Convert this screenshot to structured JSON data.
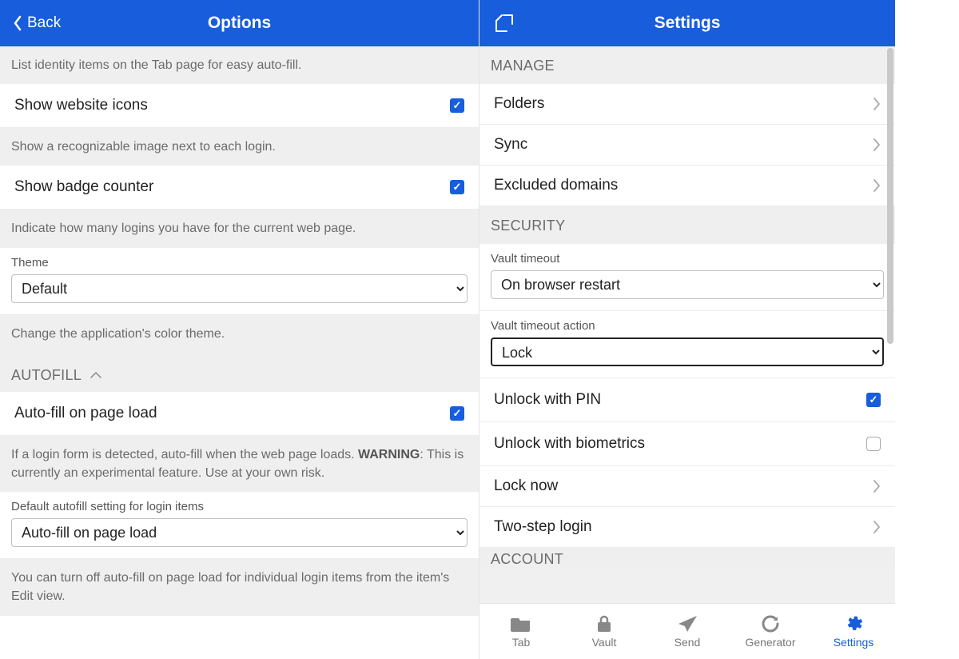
{
  "left": {
    "back_label": "Back",
    "title": "Options",
    "identity_help": "List identity items on the Tab page for easy auto-fill.",
    "show_icons": {
      "label": "Show website icons",
      "checked": true
    },
    "show_icons_help": "Show a recognizable image next to each login.",
    "badge_counter": {
      "label": "Show badge counter",
      "checked": true
    },
    "badge_counter_help": "Indicate how many logins you have for the current web page.",
    "theme": {
      "label": "Theme",
      "value": "Default"
    },
    "theme_help": "Change the application's color theme.",
    "autofill_section": "AUTOFILL",
    "autofill_page_load": {
      "label": "Auto-fill on page load",
      "checked": true
    },
    "autofill_help_pre": "If a login form is detected, auto-fill when the web page loads. ",
    "autofill_warning_label": "WARNING",
    "autofill_help_post": ": This is currently an experimental feature. Use at your own risk.",
    "default_autofill": {
      "label": "Default autofill setting for login items",
      "value": "Auto-fill on page load"
    },
    "default_autofill_help": "You can turn off auto-fill on page load for individual login items from the item's Edit view."
  },
  "right": {
    "title": "Settings",
    "manage_section": "MANAGE",
    "folders": "Folders",
    "sync": "Sync",
    "excluded": "Excluded domains",
    "security_section": "SECURITY",
    "vault_timeout": {
      "label": "Vault timeout",
      "value": "On browser restart"
    },
    "vault_timeout_action": {
      "label": "Vault timeout action",
      "value": "Lock"
    },
    "unlock_pin": {
      "label": "Unlock with PIN",
      "checked": true
    },
    "unlock_bio": {
      "label": "Unlock with biometrics",
      "checked": false
    },
    "lock_now": "Lock now",
    "two_step": "Two-step login",
    "account_section": "ACCOUNT"
  },
  "tabbar": {
    "tab": "Tab",
    "vault": "Vault",
    "send": "Send",
    "generator": "Generator",
    "settings": "Settings"
  }
}
